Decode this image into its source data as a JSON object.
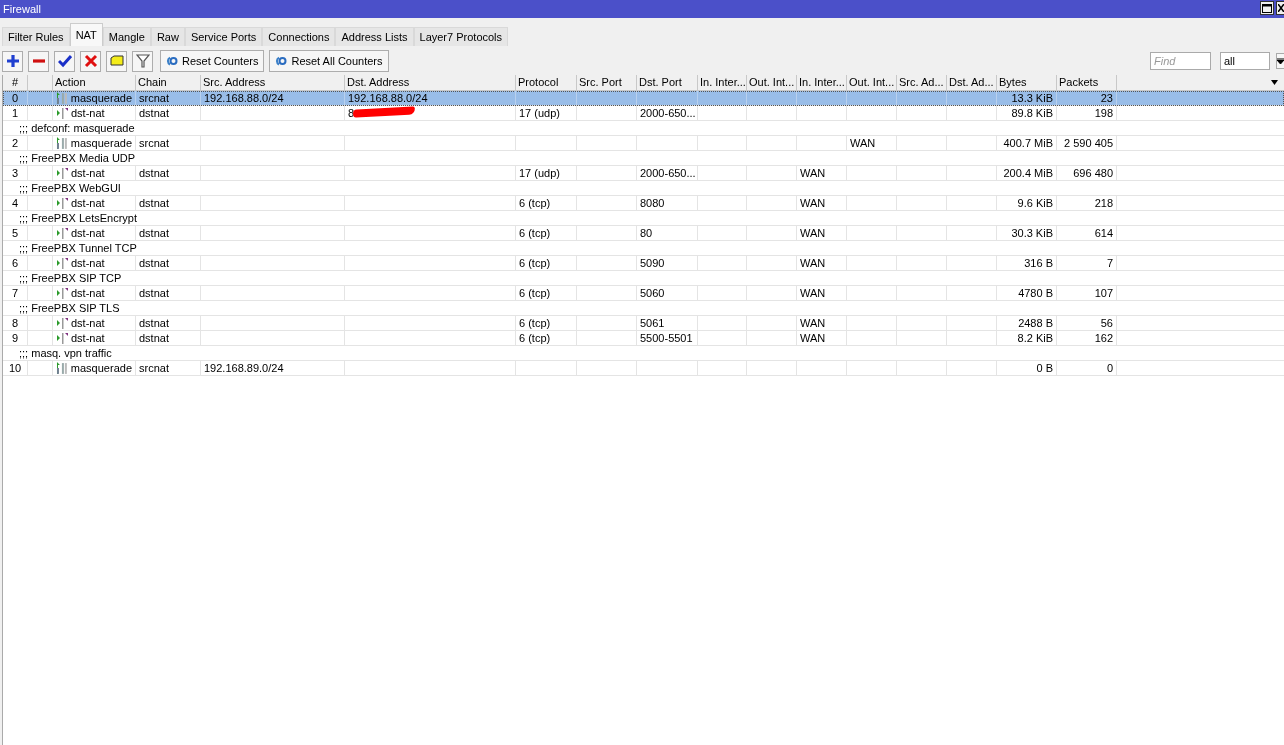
{
  "window": {
    "title": "Firewall"
  },
  "tabs": [
    {
      "label": "Filter Rules",
      "selected": false
    },
    {
      "label": "NAT",
      "selected": true
    },
    {
      "label": "Mangle",
      "selected": false
    },
    {
      "label": "Raw",
      "selected": false
    },
    {
      "label": "Service Ports",
      "selected": false
    },
    {
      "label": "Connections",
      "selected": false
    },
    {
      "label": "Address Lists",
      "selected": false
    },
    {
      "label": "Layer7 Protocols",
      "selected": false
    }
  ],
  "toolbar": {
    "icon_buttons": [
      {
        "kind": "add"
      },
      {
        "kind": "remove"
      },
      {
        "kind": "enable"
      },
      {
        "kind": "disable"
      },
      {
        "kind": "comment"
      },
      {
        "kind": "filter"
      }
    ],
    "buttons": [
      {
        "label": "Reset Counters"
      },
      {
        "label": "Reset All Counters"
      }
    ],
    "find": {
      "placeholder": "Find"
    },
    "filter_value": "all"
  },
  "table": {
    "columns": [
      "#",
      "Action",
      "Chain",
      "Src. Address",
      "Dst. Address",
      "Protocol",
      "Src. Port",
      "Dst. Port",
      "In. Inter...",
      "Out. Int...",
      "In. Inter...",
      "Out. Int...",
      "Src. Ad...",
      "Dst. Ad...",
      "Bytes",
      "Packets"
    ],
    "rows": [
      {
        "kind": "masquerade",
        "selected": true,
        "number": "0",
        "action": "masquerade",
        "chain": "srcnat",
        "src_address": "192.168.88.0/24",
        "dst_address": "192.168.88.0/24",
        "bytes": "13.3 KiB",
        "packets": "23"
      },
      {
        "kind": "dst_nat",
        "selected": false,
        "number": "1",
        "action": "dst-nat",
        "chain": "dstnat",
        "dst_address": "8",
        "dst_address_redacted": true,
        "protocol": "17 (udp)",
        "dst_port": "2000-650...",
        "bytes": "89.8 KiB",
        "packets": "198"
      },
      {
        "kind": "comment",
        "text": ";;; defconf: masquerade"
      },
      {
        "kind": "masquerade",
        "selected": false,
        "number": "2",
        "action": "masquerade",
        "chain": "srcnat",
        "out_interface_list": "WAN",
        "bytes": "400.7 MiB",
        "packets": "2 590 405"
      },
      {
        "kind": "comment",
        "text": ";;; FreePBX Media UDP"
      },
      {
        "kind": "dst_nat",
        "selected": false,
        "number": "3",
        "action": "dst-nat",
        "chain": "dstnat",
        "protocol": "17 (udp)",
        "dst_port": "2000-650...",
        "in_interface_list": "WAN",
        "bytes": "200.4 MiB",
        "packets": "696 480"
      },
      {
        "kind": "comment",
        "text": ";;; FreePBX WebGUI"
      },
      {
        "kind": "dst_nat",
        "selected": false,
        "number": "4",
        "action": "dst-nat",
        "chain": "dstnat",
        "protocol": "6 (tcp)",
        "dst_port": "8080",
        "in_interface_list": "WAN",
        "bytes": "9.6 KiB",
        "packets": "218"
      },
      {
        "kind": "comment",
        "text": ";;; FreePBX LetsEncrypt"
      },
      {
        "kind": "dst_nat",
        "selected": false,
        "number": "5",
        "action": "dst-nat",
        "chain": "dstnat",
        "protocol": "6 (tcp)",
        "dst_port": "80",
        "in_interface_list": "WAN",
        "bytes": "30.3 KiB",
        "packets": "614"
      },
      {
        "kind": "comment",
        "text": ";;; FreePBX Tunnel TCP"
      },
      {
        "kind": "dst_nat",
        "selected": false,
        "number": "6",
        "action": "dst-nat",
        "chain": "dstnat",
        "protocol": "6 (tcp)",
        "dst_port": "5090",
        "in_interface_list": "WAN",
        "bytes": "316 B",
        "packets": "7"
      },
      {
        "kind": "comment",
        "text": ";;; FreePBX SIP TCP"
      },
      {
        "kind": "dst_nat",
        "selected": false,
        "number": "7",
        "action": "dst-nat",
        "chain": "dstnat",
        "protocol": "6 (tcp)",
        "dst_port": "5060",
        "in_interface_list": "WAN",
        "bytes": "4780 B",
        "packets": "107"
      },
      {
        "kind": "comment",
        "text": ";;; FreePBX SIP TLS"
      },
      {
        "kind": "dst_nat",
        "selected": false,
        "number": "8",
        "action": "dst-nat",
        "chain": "dstnat",
        "protocol": "6 (tcp)",
        "dst_port": "5061",
        "in_interface_list": "WAN",
        "bytes": "2488 B",
        "packets": "56"
      },
      {
        "kind": "dst_nat",
        "selected": false,
        "number": "9",
        "action": "dst-nat",
        "chain": "dstnat",
        "protocol": "6 (tcp)",
        "dst_port": "5500-5501",
        "in_interface_list": "WAN",
        "bytes": "8.2 KiB",
        "packets": "162"
      },
      {
        "kind": "comment",
        "text": ";;; masq. vpn traffic"
      },
      {
        "kind": "masquerade",
        "selected": false,
        "number": "10",
        "action": "masquerade",
        "chain": "srcnat",
        "src_address": "192.168.89.0/24",
        "bytes": "0 B",
        "packets": "0"
      }
    ]
  }
}
